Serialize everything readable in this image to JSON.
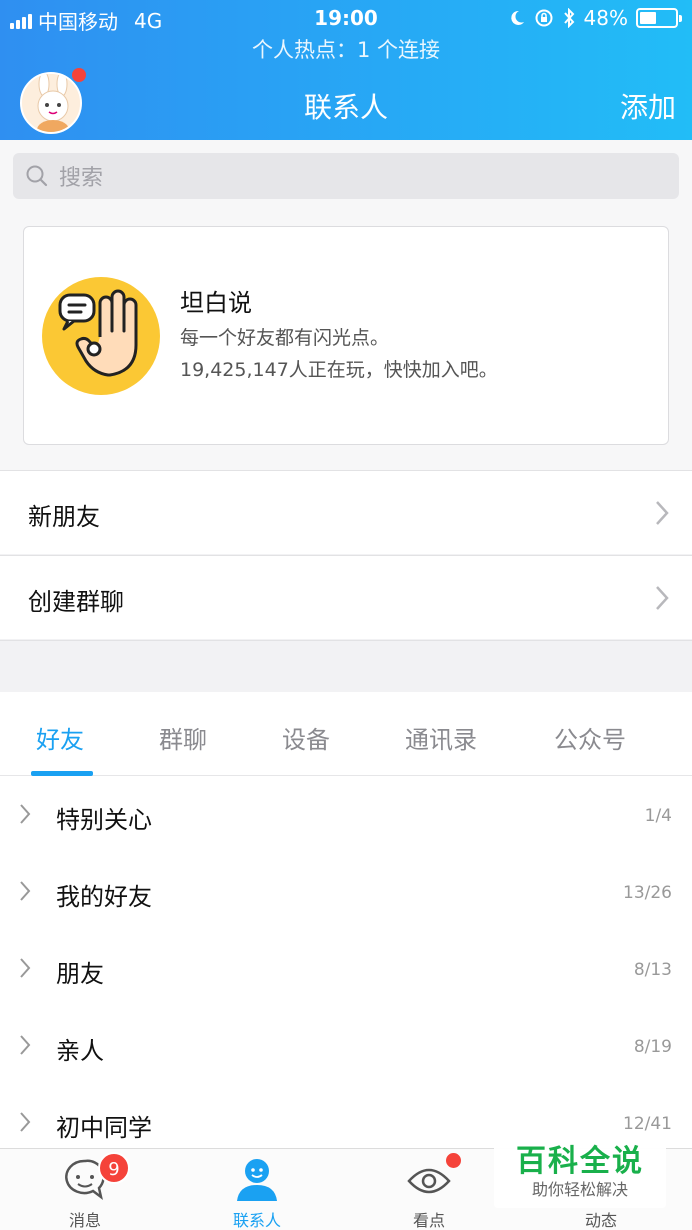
{
  "status_bar": {
    "carrier": "中国移动",
    "network": "4G",
    "time": "19:00",
    "battery": "48%",
    "battery_level": 0.48,
    "hotspot": "个人热点：1 个连接"
  },
  "header": {
    "title": "联系人",
    "add_label": "添加"
  },
  "search": {
    "placeholder": "搜索"
  },
  "banner": {
    "title": "坦白说",
    "subtitle": "每一个好友都有闪光点。",
    "count_text": "19,425,147人正在玩，快快加入吧。"
  },
  "menu": {
    "new_friends": "新朋友",
    "create_group": "创建群聊"
  },
  "tabs": [
    "好友",
    "群聊",
    "设备",
    "通讯录",
    "公众号"
  ],
  "groups": [
    {
      "name": "特别关心",
      "count": "1/4"
    },
    {
      "name": "我的好友",
      "count": "13/26"
    },
    {
      "name": "朋友",
      "count": "8/13"
    },
    {
      "name": "亲人",
      "count": "8/19"
    },
    {
      "name": "初中同学",
      "count": "12/41"
    }
  ],
  "tabbar": {
    "messages": "消息",
    "messages_badge": "9",
    "contacts": "联系人",
    "watch": "看点",
    "moments": "动态"
  },
  "watermark": {
    "title": "百科全说",
    "subtitle": "助你轻松解决"
  },
  "colors": {
    "accent": "#1aa1f2",
    "header_start": "#2f8ff1",
    "header_end": "#22bdf7",
    "badge": "#f5433a",
    "watermark_green": "#19b04b"
  }
}
